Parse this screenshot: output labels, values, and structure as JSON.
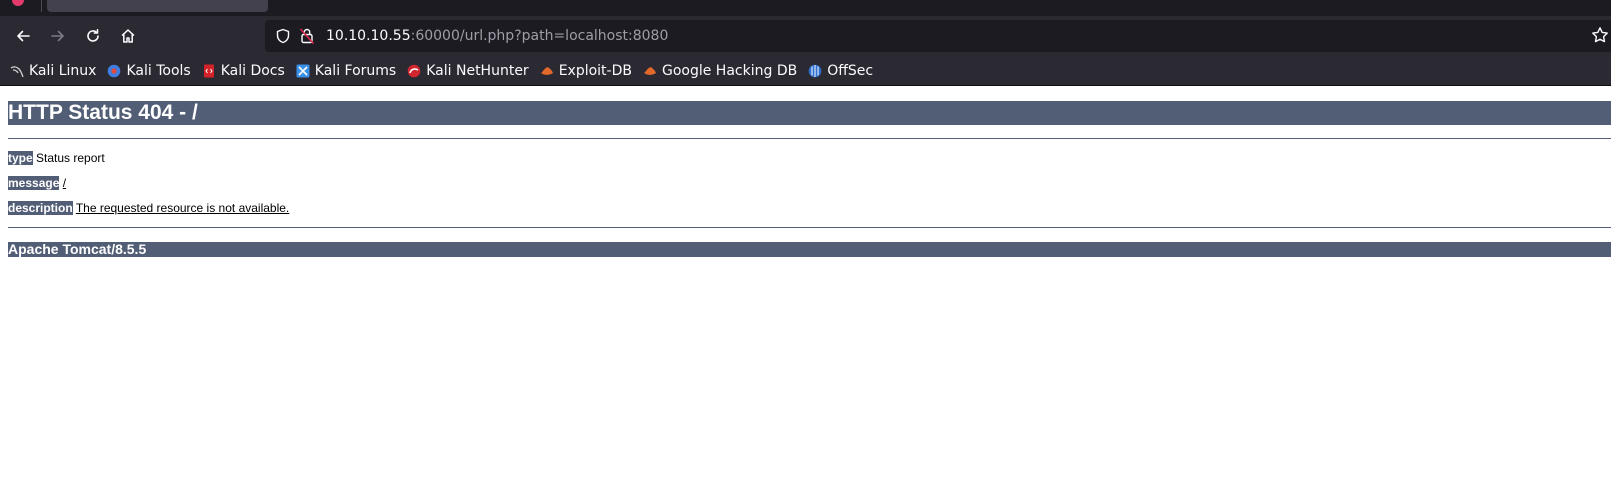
{
  "browser": {
    "active_tab_title": "",
    "inactive_tab_title": "",
    "url": {
      "host": "10.10.10.55",
      "rest": ":60000/url.php?path=localhost:8080"
    },
    "bookmarks": [
      {
        "label": "Kali Linux",
        "icon": "kali-dragon-icon",
        "color": "#cfcfd4"
      },
      {
        "label": "Kali Tools",
        "icon": "kali-tools-icon",
        "color": "#3f7de0"
      },
      {
        "label": "Kali Docs",
        "icon": "kali-docs-icon",
        "color": "#d4222a"
      },
      {
        "label": "Kali Forums",
        "icon": "kali-forums-icon",
        "color": "#3a8fe8"
      },
      {
        "label": "Kali NetHunter",
        "icon": "kali-nethunter-icon",
        "color": "#d1262f"
      },
      {
        "label": "Exploit-DB",
        "icon": "exploit-db-icon",
        "color": "#e3692b"
      },
      {
        "label": "Google Hacking DB",
        "icon": "google-hacking-db-icon",
        "color": "#e3692b"
      },
      {
        "label": "OffSec",
        "icon": "offsec-icon",
        "color": "#2f6fd1"
      }
    ]
  },
  "page": {
    "title": "HTTP Status 404 - /",
    "type_label": "type",
    "type_value": "Status report",
    "message_label": "message",
    "message_value": "/",
    "description_label": "description",
    "description_value": "The requested resource is not available.",
    "server": "Apache Tomcat/8.5.5",
    "accent_color": "#525d76"
  }
}
